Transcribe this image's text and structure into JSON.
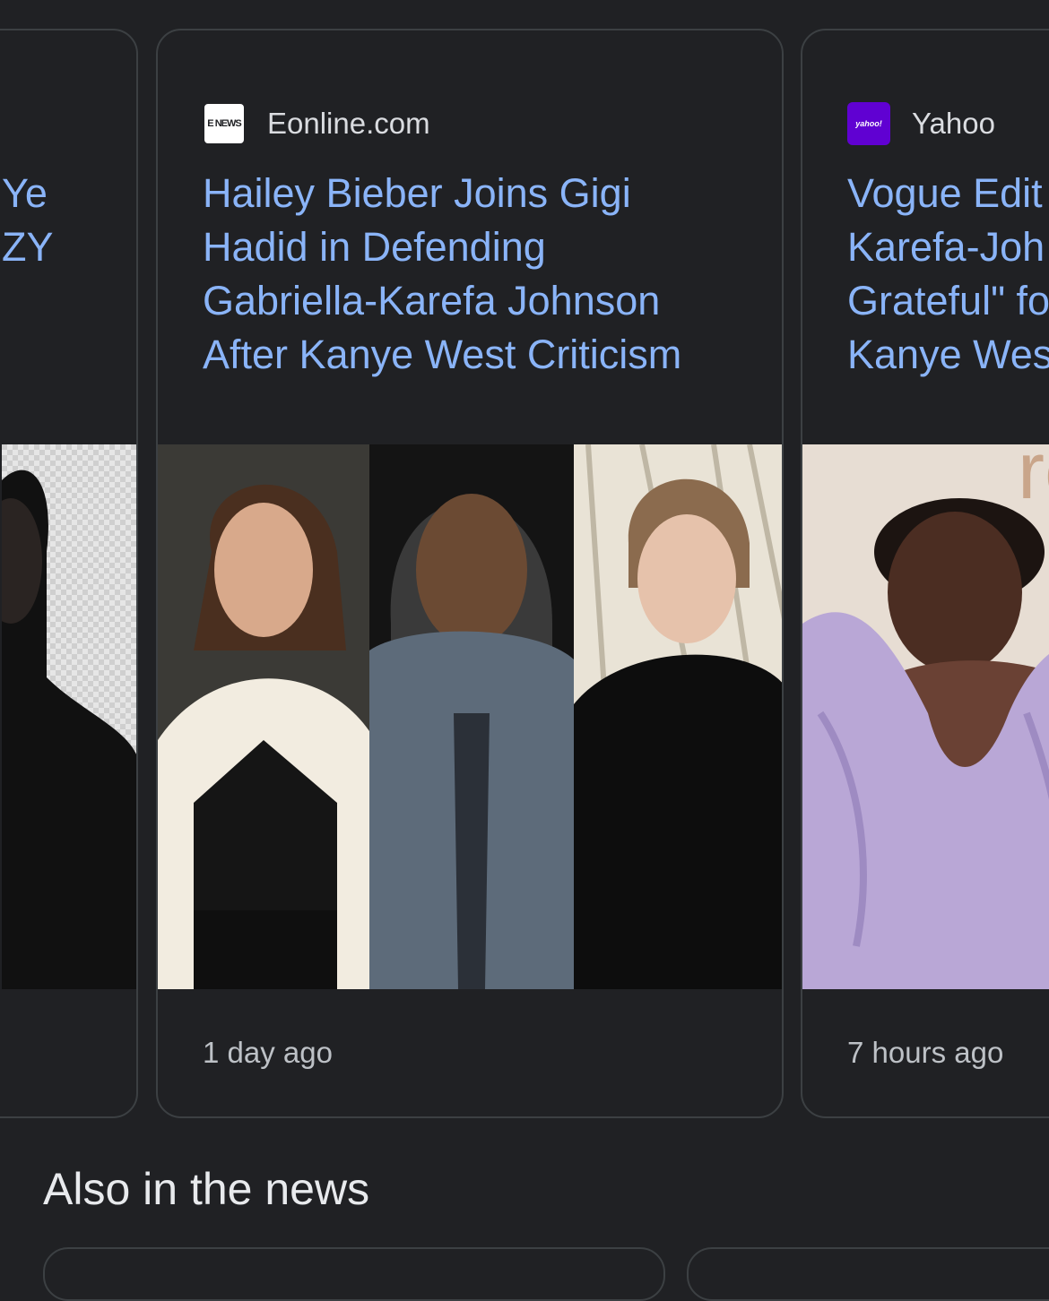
{
  "cards": [
    {
      "headline_lines": "Ye\nZY"
    },
    {
      "source": "Eonline.com",
      "logo_text": "E NEWS",
      "headline": "Hailey Bieber Joins Gigi\nHadid in Defending\nGabriella-Karefa Johnson\nAfter Kanye West Criticism",
      "time": "1 day ago"
    },
    {
      "source": "Yahoo",
      "logo_text": "yahoo!",
      "headline": "Vogue Edit\nKarefa-Joh\nGrateful\" fo\nKanye Wes",
      "time": "7 hours ago"
    }
  ],
  "section_title": "Also in the news",
  "colors": {
    "background": "#202124",
    "link": "#8ab4f8",
    "border": "#3c4043",
    "yahoo": "#6001d2"
  }
}
